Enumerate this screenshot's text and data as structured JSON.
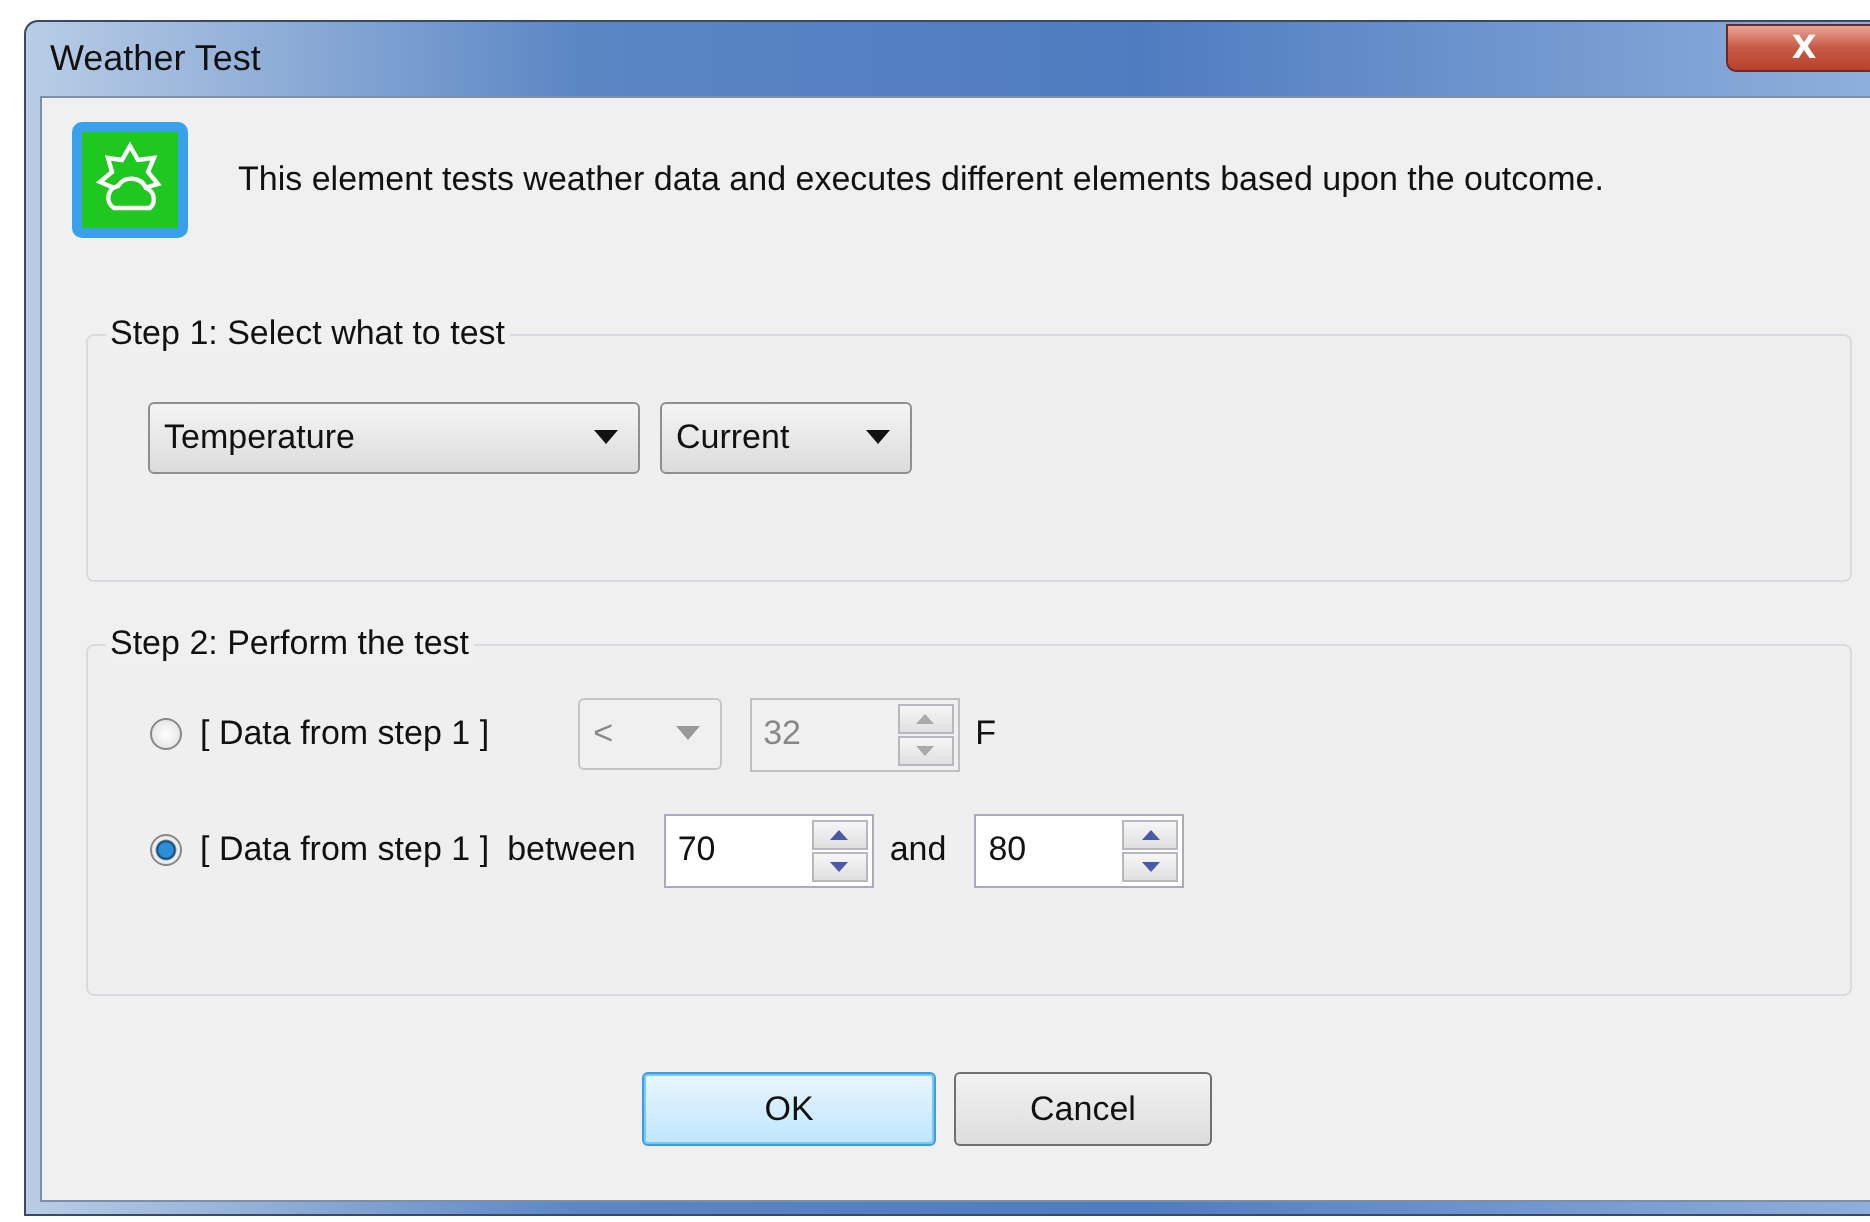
{
  "window": {
    "title": "Weather Test",
    "close": "X"
  },
  "description": "This element tests weather data and executes different elements based upon the outcome.",
  "step1": {
    "title": "Step 1: Select what to test",
    "dropdowns": [
      {
        "kind": "wide",
        "value": "Temperature"
      },
      {
        "kind": "narrow",
        "value": "Current"
      }
    ]
  },
  "step2": {
    "title": "Step 2: Perform the test",
    "options": [
      {
        "kind": "compare",
        "selected": false,
        "source": "[ Data from step 1 ]",
        "operator": "<",
        "value": "32",
        "unit": "F"
      },
      {
        "kind": "between",
        "selected": true,
        "source": "[ Data from step 1 ]",
        "between_label": "between",
        "low": "70",
        "and_label": "and",
        "high": "80"
      }
    ]
  },
  "buttons": [
    {
      "label": "OK",
      "default": true
    },
    {
      "label": "Cancel",
      "default": false
    }
  ]
}
